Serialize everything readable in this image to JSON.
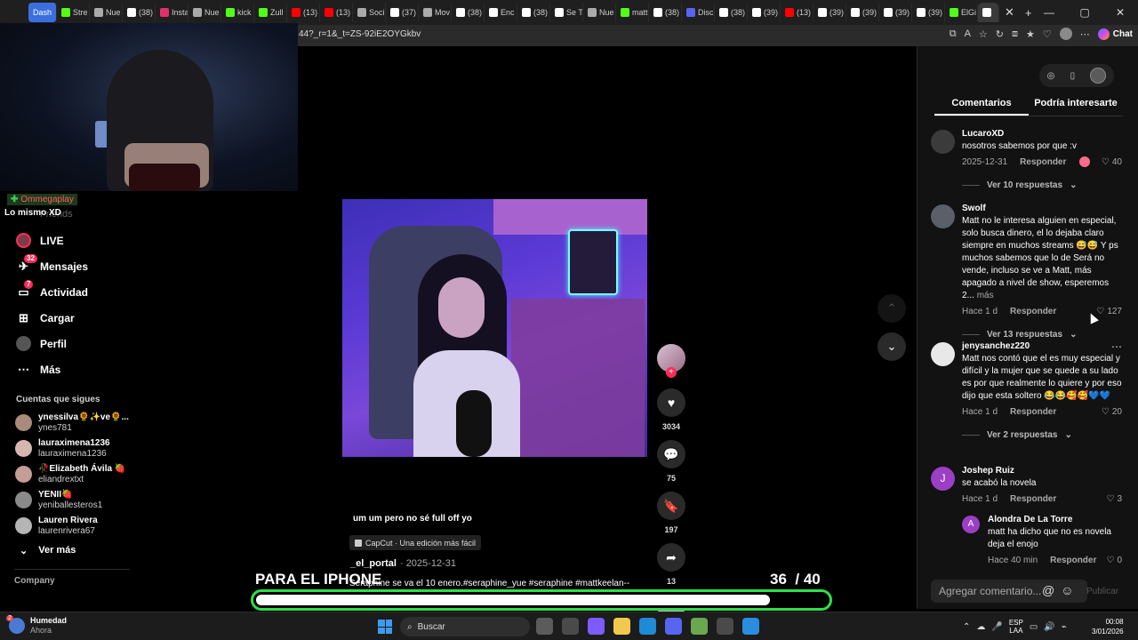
{
  "browser": {
    "tabs": [
      {
        "label": "Dash",
        "color": "#3b6fe0"
      },
      {
        "label": "Stre",
        "color": "#53fc18"
      },
      {
        "label": "Nue",
        "color": "#aaaaaa"
      },
      {
        "label": "(38)",
        "color": "#ffffff"
      },
      {
        "label": "Insta",
        "color": "#e1306c"
      },
      {
        "label": "Nue",
        "color": "#aaaaaa"
      },
      {
        "label": "kick",
        "color": "#53fc18"
      },
      {
        "label": "Zull",
        "color": "#53fc18"
      },
      {
        "label": "(13)",
        "color": "#ff0000"
      },
      {
        "label": "(13)",
        "color": "#ff0000"
      },
      {
        "label": "Soci",
        "color": "#aaaaaa"
      },
      {
        "label": "(37)",
        "color": "#ffffff"
      },
      {
        "label": "Mov",
        "color": "#aaaaaa"
      },
      {
        "label": "(38)",
        "color": "#ffffff"
      },
      {
        "label": "Enc",
        "color": "#ffffff"
      },
      {
        "label": "(38)",
        "color": "#ffffff"
      },
      {
        "label": "Se T",
        "color": "#ffffff"
      },
      {
        "label": "Nue",
        "color": "#aaaaaa"
      },
      {
        "label": "matt",
        "color": "#53fc18"
      },
      {
        "label": "(38)",
        "color": "#ffffff"
      },
      {
        "label": "Disc",
        "color": "#5865f2"
      },
      {
        "label": "(38)",
        "color": "#ffffff"
      },
      {
        "label": "(39)",
        "color": "#ffffff"
      },
      {
        "label": "(13)",
        "color": "#ff0000"
      },
      {
        "label": "(39)",
        "color": "#ffffff"
      },
      {
        "label": "(39)",
        "color": "#ffffff"
      },
      {
        "label": "(39)",
        "color": "#ffffff"
      },
      {
        "label": "(39)",
        "color": "#ffffff"
      },
      {
        "label": "ElGi",
        "color": "#53fc18"
      },
      {
        "label": "",
        "color": "#ffffff"
      }
    ],
    "url": "44?_r=1&_t=ZS-92iE2OYGkbv",
    "chat_label": "Chat"
  },
  "stream_overlay": {
    "tag": "Ommegaplay",
    "sub": "Lo mismo XD",
    "behind_text": "Friends",
    "title": "PARA EL IPHONE",
    "count": "36",
    "total": "/ 40",
    "progress": 0.9
  },
  "sidebar": {
    "nav": [
      {
        "label": "LIVE",
        "icon": "live-icon",
        "badge": ""
      },
      {
        "label": "Mensajes",
        "icon": "messages-icon",
        "badge": "32"
      },
      {
        "label": "Actividad",
        "icon": "activity-icon",
        "badge": "7"
      },
      {
        "label": "Cargar",
        "icon": "upload-icon",
        "badge": ""
      },
      {
        "label": "Perfil",
        "icon": "profile-icon",
        "badge": ""
      },
      {
        "label": "Más",
        "icon": "more-icon",
        "badge": ""
      }
    ],
    "following_title": "Cuentas que sigues",
    "following": [
      {
        "name": "ynessilva🌻✨ve🌻...",
        "user": "ynes781",
        "color": "#a98a7c"
      },
      {
        "name": "lauraximena1236",
        "user": "lauraximena1236",
        "color": "#d8b6b0"
      },
      {
        "name": "🥀Elizabeth Ávila 🍓",
        "user": "eliandrextxt",
        "color": "#c49d96"
      },
      {
        "name": "YENII🍓",
        "user": "yeniballesteros1",
        "color": "#8a8a8a"
      },
      {
        "name": "Lauren Rivera",
        "user": "laurenrivera67",
        "color": "#b5b5b5"
      }
    ],
    "see_more": "Ver más",
    "company": "Company"
  },
  "video": {
    "caption": "um um pero no sé full off yo",
    "capcut": "CapCut · Una edición más fácil",
    "author": "_el_portal",
    "date": "· 2025-12-31",
    "description": "Seraphine se va el 10 enero.#seraphine_yue #seraphine #mattkeelan--",
    "likes": "3034",
    "comments": "75",
    "saves": "197",
    "shares": "13"
  },
  "panel": {
    "tabs": [
      "Comentarios",
      "Podría interesarte"
    ],
    "comments": [
      {
        "name": "LucaroXD",
        "text": "nosotros sabemos por que :v",
        "more": "",
        "date": "2025-12-31",
        "reply": "Responder",
        "likes": "40",
        "replies": "Ver 10 respuestas",
        "avatar": "",
        "color": "#3b3b3b"
      },
      {
        "name": "Swolf",
        "text": "Matt no le interesa alguien en especial, solo busca dinero, el lo dejaba claro siempre en muchos streams 😅😅 Y ps muchos sabemos que lo de Será no vende, incluso se ve a Matt, más apagado a nivel de show, esperemos 2...",
        "more": "más",
        "date": "Hace 1 d",
        "reply": "Responder",
        "likes": "127",
        "replies": "Ver 13 respuestas",
        "avatar": "",
        "color": "#5a5f6a"
      },
      {
        "name": "jenysanchez220",
        "text": "Matt nos contó que el es muy especial y difícil y la mujer que se quede a su lado es por que realmente lo quiere y por eso dijo que esta soltero 😂😂🥰🥰💙💙",
        "more": "",
        "date": "Hace 1 d",
        "reply": "Responder",
        "likes": "20",
        "replies": "Ver 2 respuestas",
        "avatar": "",
        "color": "#e8e8e8"
      },
      {
        "name": "Joshep Ruiz",
        "text": "se acabó la novela",
        "more": "",
        "date": "Hace 1 d",
        "reply": "Responder",
        "likes": "3",
        "replies": "",
        "avatar": "J",
        "color": "#9b3fc4"
      }
    ],
    "nested_reply": {
      "name": "Alondra De La Torre",
      "text": "matt ha dicho que no es novela deja el enojo",
      "date": "Hace 40 min",
      "reply": "Responder",
      "likes": "0",
      "avatar": "A",
      "color": "#9b3fc4"
    },
    "add_comment_placeholder": "Agregar comentario...",
    "publish": "Publicar"
  },
  "taskbar": {
    "weather_title": "Humedad",
    "weather_sub": "Ahora",
    "weather_badge": "2",
    "search": "Buscar",
    "apps": [
      "#5b5b5b",
      "#4a4a4a",
      "#7c5cff",
      "#f2c94c",
      "#1f8ad6",
      "#5865f2",
      "#6aa84f",
      "#4a4a4a",
      "#2b8de0"
    ],
    "lang_top": "ESP",
    "lang_bottom": "LAA",
    "time": "00:08",
    "date": "3/01/2026"
  }
}
